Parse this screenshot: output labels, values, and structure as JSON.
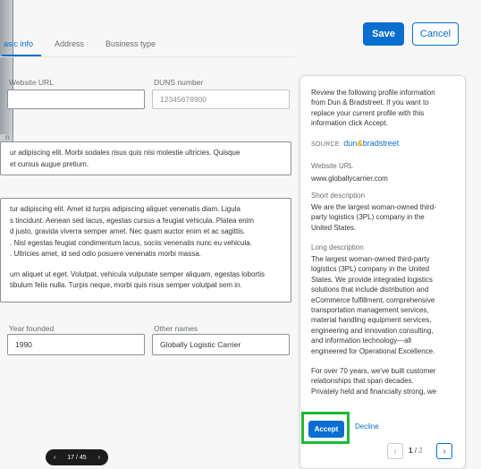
{
  "header": {
    "save_label": "Save",
    "cancel_label": "Cancel",
    "tabs": [
      {
        "label": "asic info"
      },
      {
        "label": "Address"
      },
      {
        "label": "Business type"
      }
    ]
  },
  "form": {
    "website_url_label": "Website URL",
    "website_url_value": "",
    "duns_label": "DUNS number",
    "duns_value": "12345678900",
    "short_desc_label": "n",
    "short_desc_lines": [
      "ur adipiscing elit. Morbi sodales risus quis nisi molestie ultricies. Quisque",
      "et cursus augue pretium."
    ],
    "long_desc_lines": [
      "tur adipiscing elit. Amet id turpis adipiscing aliquet venenatis diam. Ligula",
      "s tincidunt. Aenean sed lacus, egestas cursus a feugiat vehicula. Platea enim",
      "d justo, gravida viverra semper amet. Nec quam auctor enim et ac sagittis.",
      ". Nisl egestas feugiat condimentum lacus, sociis venenatis nunc eu vehicula.",
      ". Ultricies amet, id sed odio posuere venenatis morbi massa.",
      "",
      "um aliquet ut eget. Volutpat, vehicula vulputate semper aliquam, egestas lobortis",
      "tibulum felis nulla. Turpis neque, morbi quis risus semper volutpat sem in."
    ],
    "year_founded_label": "Year founded",
    "year_founded_value": "1990",
    "other_names_label": "Other names",
    "other_names_value": "Globally Logistic Carrier"
  },
  "panel": {
    "intro_lines": [
      "Review the following profile information",
      "from Dun & Bradstreet. If you want to",
      "replace your current profile with this",
      "information click Accept."
    ],
    "source_label": "SOURCE:",
    "source_logo_prefix": "dun",
    "source_logo_amp": "&",
    "source_logo_suffix": "bradstreet",
    "website_label": "Website URL",
    "website_value": "www.globallycarrier.com",
    "short_label": "Short description",
    "short_lines": [
      "We are the largest woman-owned third-",
      "party logistics (3PL) company in the",
      "United States."
    ],
    "long_label": "Long description",
    "long_lines": [
      "The largest woman-owned third-party",
      "logistics (3PL) company in the United",
      "States. We provide integrated logistics",
      "solutions that include distribution and",
      "eCommerce fulfillment, comprehensive",
      "transportation management services,",
      "material handling equipment services,",
      "engineering and innovation consulting,",
      "and information technology—all",
      "engineered for Operational Excellence.",
      "",
      "For over 70 years, we've built customer",
      "relationships that span decades.",
      "Privately held and financially strong, we"
    ],
    "accept_label": "Accept",
    "decline_label": "Decline",
    "pager_current": "1",
    "pager_sep": "/",
    "pager_total": "2"
  },
  "page_pill": {
    "prev_glyph": "‹",
    "text": "17 / 45",
    "next_glyph": "›"
  },
  "icons": {
    "chevron_left": "‹",
    "chevron_right": "›"
  },
  "colors": {
    "accent": "#0a6ed1",
    "highlight": "#1db934"
  }
}
